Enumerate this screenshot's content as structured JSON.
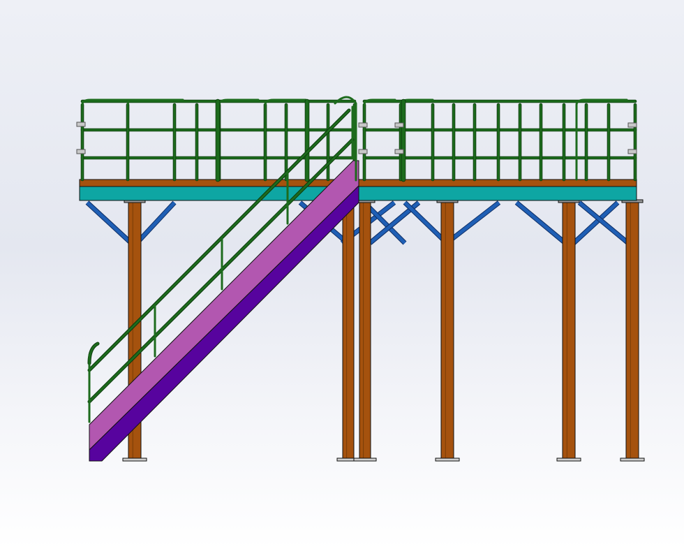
{
  "viewport": {
    "background": "gradient-gray-white"
  },
  "model": {
    "type": "steel-platform-with-stair",
    "colors": {
      "column": "#a5520e",
      "beam_top": "#a5520e",
      "deck": "#0ea6a3",
      "brace": "#1f5fb5",
      "railing": "#1d6b1d",
      "stringer_face": "#b257b0",
      "stringer_bottom": "#57039e",
      "outline": "#111111",
      "bolt": "#c8c8c8"
    }
  }
}
